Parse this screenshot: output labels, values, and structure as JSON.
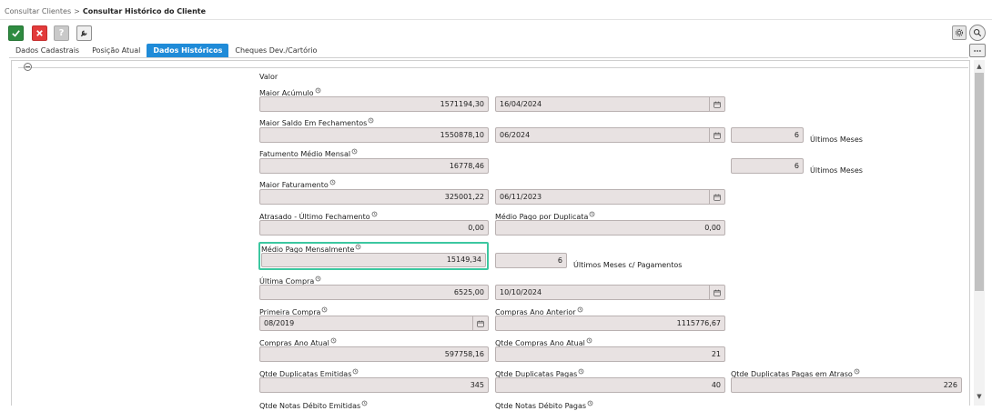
{
  "breadcrumb": {
    "parent": "Consultar Clientes",
    "separator": ">",
    "current": "Consultar Histórico do Cliente"
  },
  "toolbar": {
    "confirm_icon": "check-icon",
    "cancel_icon": "close-icon",
    "help_label": "?",
    "tools_icon": "wrench-icon"
  },
  "tabs": [
    {
      "label": "Dados Cadastrais",
      "active": false
    },
    {
      "label": "Posição Atual",
      "active": false
    },
    {
      "label": "Dados Históricos",
      "active": true
    },
    {
      "label": "Cheques Dev./Cartório",
      "active": false
    }
  ],
  "section": {
    "title": "Valor"
  },
  "fields": {
    "maior_acumulo": {
      "label": "Maior Acúmulo",
      "value": "1571194,30",
      "date": "16/04/2024"
    },
    "maior_saldo": {
      "label": "Maior Saldo Em Fechamentos",
      "value": "1550878,10",
      "date": "06/2024",
      "months": "6",
      "months_suffix": "Últimos Meses"
    },
    "faturamento_medio": {
      "label": "Fatumento Médio Mensal",
      "value": "16778,46",
      "months": "6",
      "months_suffix": "Últimos Meses"
    },
    "maior_faturamento": {
      "label": "Maior Faturamento",
      "value": "325001,22",
      "date": "06/11/2023"
    },
    "atrasado": {
      "label": "Atrasado - Último Fechamento",
      "value": "0,00"
    },
    "medio_pago_duplicata": {
      "label": "Médio Pago por Duplicata",
      "value": "0,00"
    },
    "medio_pago_mensal": {
      "label": "Médio Pago Mensalmente",
      "value": "15149,34",
      "months": "6",
      "months_suffix": "Últimos Meses c/ Pagamentos"
    },
    "ultima_compra": {
      "label": "Última Compra",
      "value": "6525,00",
      "date": "10/10/2024"
    },
    "primeira_compra": {
      "label": "Primeira Compra",
      "date": "08/2019"
    },
    "compras_ano_anterior": {
      "label": "Compras Ano Anterior",
      "value": "1115776,67"
    },
    "compras_ano_atual": {
      "label": "Compras Ano Atual",
      "value": "597758,16"
    },
    "qtde_compras_ano_atual": {
      "label": "Qtde Compras Ano Atual",
      "value": "21"
    },
    "qtde_duplicatas_emitidas": {
      "label": "Qtde Duplicatas Emitidas",
      "value": "345"
    },
    "qtde_duplicatas_pagas": {
      "label": "Qtde Duplicatas Pagas",
      "value": "40"
    },
    "qtde_duplicatas_pagas_atraso": {
      "label": "Qtde Duplicatas Pagas em Atraso",
      "value": "226"
    },
    "qtde_notas_debito_emitidas": {
      "label": "Qtde Notas Débito Emitidas"
    },
    "qtde_notas_debito_pagas": {
      "label": "Qtde Notas Débito Pagas"
    }
  },
  "colors": {
    "accent_tab": "#1f8bd8",
    "confirm": "#2e8b40",
    "cancel": "#e23b3b",
    "focus": "#3cc7a0",
    "field_bg": "#e8e2e2"
  }
}
